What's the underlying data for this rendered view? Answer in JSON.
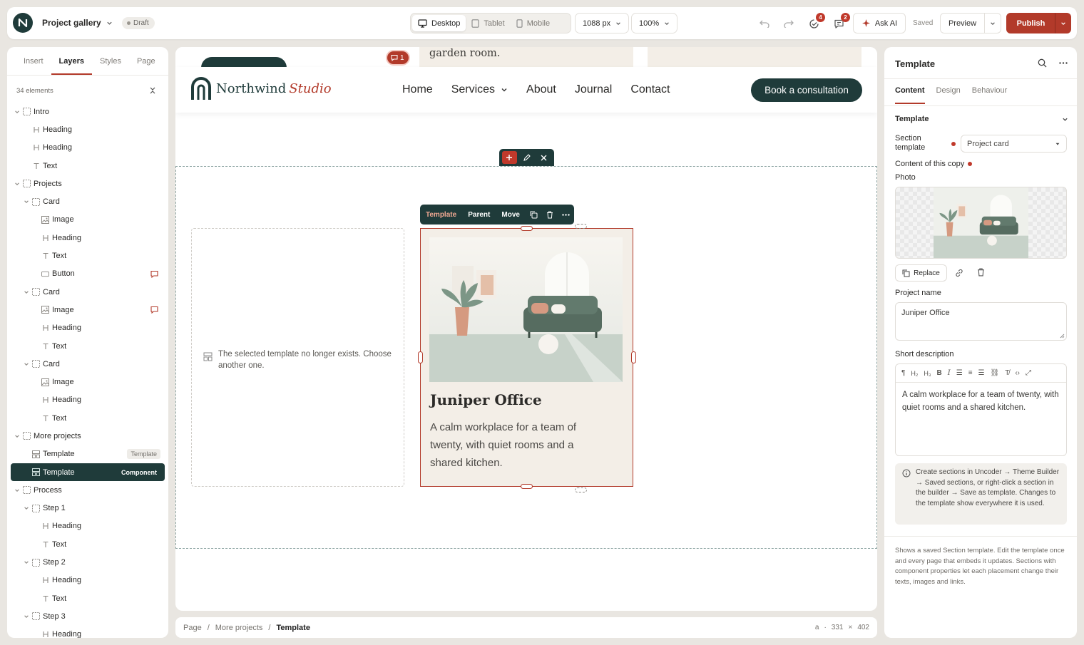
{
  "topbar": {
    "project_title": "Project gallery",
    "status": "Draft",
    "devices": [
      "Desktop",
      "Tablet",
      "Mobile"
    ],
    "active_device": "Desktop",
    "width": "1088 px",
    "zoom": "100%",
    "notifications_count": "4",
    "comments_count": "2",
    "ask_ai": "Ask AI",
    "saved": "Saved",
    "preview": "Preview",
    "publish": "Publish"
  },
  "left_panel": {
    "tabs": [
      "Insert",
      "Layers",
      "Styles",
      "Page"
    ],
    "active_tab": "Layers",
    "count": "34 elements",
    "layers": [
      {
        "label": "Intro",
        "type": "section",
        "depth": 0,
        "caret": true
      },
      {
        "label": "Heading",
        "type": "heading",
        "depth": 1
      },
      {
        "label": "Heading",
        "type": "heading",
        "depth": 1
      },
      {
        "label": "Text",
        "type": "text",
        "depth": 1
      },
      {
        "label": "Projects",
        "type": "section",
        "depth": 0,
        "caret": true
      },
      {
        "label": "Card",
        "type": "section",
        "depth": 1,
        "caret": true
      },
      {
        "label": "Image",
        "type": "image",
        "depth": 2
      },
      {
        "label": "Heading",
        "type": "heading",
        "depth": 2
      },
      {
        "label": "Text",
        "type": "text",
        "depth": 2
      },
      {
        "label": "Button",
        "type": "button",
        "depth": 2,
        "comment": true
      },
      {
        "label": "Card",
        "type": "section",
        "depth": 1,
        "caret": true
      },
      {
        "label": "Image",
        "type": "image",
        "depth": 2,
        "comment": true
      },
      {
        "label": "Heading",
        "type": "heading",
        "depth": 2
      },
      {
        "label": "Text",
        "type": "text",
        "depth": 2
      },
      {
        "label": "Card",
        "type": "section",
        "depth": 1,
        "caret": true
      },
      {
        "label": "Image",
        "type": "image",
        "depth": 2
      },
      {
        "label": "Heading",
        "type": "heading",
        "depth": 2
      },
      {
        "label": "Text",
        "type": "text",
        "depth": 2
      },
      {
        "label": "More projects",
        "type": "section",
        "depth": 0,
        "caret": true
      },
      {
        "label": "Template",
        "type": "template",
        "depth": 1,
        "tag": "Template"
      },
      {
        "label": "Template",
        "type": "template",
        "depth": 1,
        "tag": "Component",
        "selected": true
      },
      {
        "label": "Process",
        "type": "section",
        "depth": 0,
        "caret": true
      },
      {
        "label": "Step 1",
        "type": "section",
        "depth": 1,
        "caret": true
      },
      {
        "label": "Heading",
        "type": "heading",
        "depth": 2
      },
      {
        "label": "Text",
        "type": "text",
        "depth": 2
      },
      {
        "label": "Step 2",
        "type": "section",
        "depth": 1,
        "caret": true
      },
      {
        "label": "Heading",
        "type": "heading",
        "depth": 2
      },
      {
        "label": "Text",
        "type": "text",
        "depth": 2
      },
      {
        "label": "Step 3",
        "type": "section",
        "depth": 1,
        "caret": true
      },
      {
        "label": "Heading",
        "type": "heading",
        "depth": 2
      }
    ]
  },
  "canvas": {
    "top_text": "garden room.",
    "comment_count": "1",
    "site": {
      "brand": "Northwind",
      "brand_accent": "Studio",
      "nav": [
        "Home",
        "Services",
        "About",
        "Journal",
        "Contact"
      ],
      "cta": "Book a consultation"
    },
    "empty_message": "The selected template no longer exists. Choose another one.",
    "toolbar": [
      "Template",
      "Parent",
      "Move"
    ],
    "card": {
      "title": "Juniper Office",
      "description": "A calm workplace for a team of twenty, with quiet rooms and a shared kitchen."
    }
  },
  "breadcrumb": {
    "items": [
      "Page",
      "More projects",
      "Template"
    ],
    "tag": "a",
    "width": "331",
    "height": "402",
    "times": "×"
  },
  "right_panel": {
    "title": "Template",
    "tabs": [
      "Content",
      "Design",
      "Behaviour"
    ],
    "active_tab": "Content",
    "section_title": "Template",
    "section_template_label": "Section template",
    "section_template_value": "Project card",
    "copy_content_label": "Content of this copy",
    "photo_label": "Photo",
    "replace": "Replace",
    "project_name_label": "Project name",
    "project_name_value": "Juniper Office",
    "short_desc_label": "Short description",
    "short_desc_value": "A calm workplace for a team of twenty, with quiet rooms and a shared kitchen.",
    "info": "Create sections in Uncoder → Theme Builder → Saved sections, or right-click a section in the builder → Save as template. Changes to the template show everywhere it is used.",
    "footer": "Shows a saved Section template. Edit the template once and every page that embeds it updates. Sections with component properties let each placement change their texts, images and links."
  },
  "colors": {
    "accent": "#b23a2a",
    "dark_green": "#1f3b3a",
    "card_bg": "#f3eee7"
  }
}
